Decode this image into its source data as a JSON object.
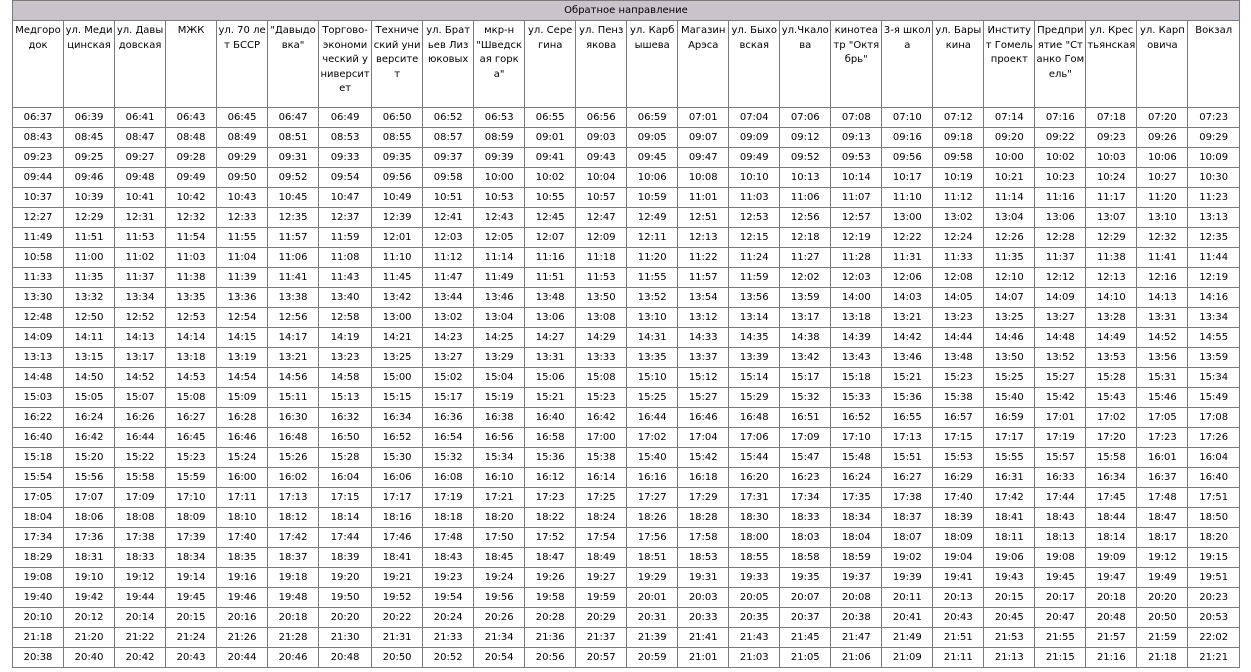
{
  "direction_title": "Обратное направление",
  "stops": [
    "Медгородок",
    "ул. Медицинская",
    "ул. Давыдовская",
    "МЖК",
    "ул. 70 лет БССР",
    "\"Давыдовка\"",
    "Торгово-экономический университет",
    "Технический университет",
    "ул. Братьев Лизюковых",
    "мкр-н \"Шведская горка\"",
    "ул. Серегина",
    "ул. Пензякова",
    "ул. Карбышева",
    "Магазин Арэса",
    "ул. Быховская",
    "ул.Чкалова",
    "кинотеатр \"Октябрь\"",
    "3-я школа",
    "ул. Барыкина",
    "Институт Гомельпроект",
    "Предприятие \"Станко Гомель\"",
    "ул. Крестьянская",
    "ул. Карповича",
    "Вокзал"
  ],
  "rows": [
    [
      "06:37",
      "06:39",
      "06:41",
      "06:43",
      "06:45",
      "06:47",
      "06:49",
      "06:50",
      "06:52",
      "06:53",
      "06:55",
      "06:56",
      "06:59",
      "07:01",
      "07:04",
      "07:06",
      "07:08",
      "07:10",
      "07:12",
      "07:14",
      "07:16",
      "07:18",
      "07:20",
      "07:23"
    ],
    [
      "08:43",
      "08:45",
      "08:47",
      "08:48",
      "08:49",
      "08:51",
      "08:53",
      "08:55",
      "08:57",
      "08:59",
      "09:01",
      "09:03",
      "09:05",
      "09:07",
      "09:09",
      "09:12",
      "09:13",
      "09:16",
      "09:18",
      "09:20",
      "09:22",
      "09:23",
      "09:26",
      "09:29"
    ],
    [
      "09:23",
      "09:25",
      "09:27",
      "09:28",
      "09:29",
      "09:31",
      "09:33",
      "09:35",
      "09:37",
      "09:39",
      "09:41",
      "09:43",
      "09:45",
      "09:47",
      "09:49",
      "09:52",
      "09:53",
      "09:56",
      "09:58",
      "10:00",
      "10:02",
      "10:03",
      "10:06",
      "10:09"
    ],
    [
      "09:44",
      "09:46",
      "09:48",
      "09:49",
      "09:50",
      "09:52",
      "09:54",
      "09:56",
      "09:58",
      "10:00",
      "10:02",
      "10:04",
      "10:06",
      "10:08",
      "10:10",
      "10:13",
      "10:14",
      "10:17",
      "10:19",
      "10:21",
      "10:23",
      "10:24",
      "10:27",
      "10:30"
    ],
    [
      "10:37",
      "10:39",
      "10:41",
      "10:42",
      "10:43",
      "10:45",
      "10:47",
      "10:49",
      "10:51",
      "10:53",
      "10:55",
      "10:57",
      "10:59",
      "11:01",
      "11:03",
      "11:06",
      "11:07",
      "11:10",
      "11:12",
      "11:14",
      "11:16",
      "11:17",
      "11:20",
      "11:23"
    ],
    [
      "12:27",
      "12:29",
      "12:31",
      "12:32",
      "12:33",
      "12:35",
      "12:37",
      "12:39",
      "12:41",
      "12:43",
      "12:45",
      "12:47",
      "12:49",
      "12:51",
      "12:53",
      "12:56",
      "12:57",
      "13:00",
      "13:02",
      "13:04",
      "13:06",
      "13:07",
      "13:10",
      "13:13"
    ],
    [
      "11:49",
      "11:51",
      "11:53",
      "11:54",
      "11:55",
      "11:57",
      "11:59",
      "12:01",
      "12:03",
      "12:05",
      "12:07",
      "12:09",
      "12:11",
      "12:13",
      "12:15",
      "12:18",
      "12:19",
      "12:22",
      "12:24",
      "12:26",
      "12:28",
      "12:29",
      "12:32",
      "12:35"
    ],
    [
      "10:58",
      "11:00",
      "11:02",
      "11:03",
      "11:04",
      "11:06",
      "11:08",
      "11:10",
      "11:12",
      "11:14",
      "11:16",
      "11:18",
      "11:20",
      "11:22",
      "11:24",
      "11:27",
      "11:28",
      "11:31",
      "11:33",
      "11:35",
      "11:37",
      "11:38",
      "11:41",
      "11:44"
    ],
    [
      "11:33",
      "11:35",
      "11:37",
      "11:38",
      "11:39",
      "11:41",
      "11:43",
      "11:45",
      "11:47",
      "11:49",
      "11:51",
      "11:53",
      "11:55",
      "11:57",
      "11:59",
      "12:02",
      "12:03",
      "12:06",
      "12:08",
      "12:10",
      "12:12",
      "12:13",
      "12:16",
      "12:19"
    ],
    [
      "13:30",
      "13:32",
      "13:34",
      "13:35",
      "13:36",
      "13:38",
      "13:40",
      "13:42",
      "13:44",
      "13:46",
      "13:48",
      "13:50",
      "13:52",
      "13:54",
      "13:56",
      "13:59",
      "14:00",
      "14:03",
      "14:05",
      "14:07",
      "14:09",
      "14:10",
      "14:13",
      "14:16"
    ],
    [
      "12:48",
      "12:50",
      "12:52",
      "12:53",
      "12:54",
      "12:56",
      "12:58",
      "13:00",
      "13:02",
      "13:04",
      "13:06",
      "13:08",
      "13:10",
      "13:12",
      "13:14",
      "13:17",
      "13:18",
      "13:21",
      "13:23",
      "13:25",
      "13:27",
      "13:28",
      "13:31",
      "13:34"
    ],
    [
      "14:09",
      "14:11",
      "14:13",
      "14:14",
      "14:15",
      "14:17",
      "14:19",
      "14:21",
      "14:23",
      "14:25",
      "14:27",
      "14:29",
      "14:31",
      "14:33",
      "14:35",
      "14:38",
      "14:39",
      "14:42",
      "14:44",
      "14:46",
      "14:48",
      "14:49",
      "14:52",
      "14:55"
    ],
    [
      "13:13",
      "13:15",
      "13:17",
      "13:18",
      "13:19",
      "13:21",
      "13:23",
      "13:25",
      "13:27",
      "13:29",
      "13:31",
      "13:33",
      "13:35",
      "13:37",
      "13:39",
      "13:42",
      "13:43",
      "13:46",
      "13:48",
      "13:50",
      "13:52",
      "13:53",
      "13:56",
      "13:59"
    ],
    [
      "14:48",
      "14:50",
      "14:52",
      "14:53",
      "14:54",
      "14:56",
      "14:58",
      "15:00",
      "15:02",
      "15:04",
      "15:06",
      "15:08",
      "15:10",
      "15:12",
      "15:14",
      "15:17",
      "15:18",
      "15:21",
      "15:23",
      "15:25",
      "15:27",
      "15:28",
      "15:31",
      "15:34"
    ],
    [
      "15:03",
      "15:05",
      "15:07",
      "15:08",
      "15:09",
      "15:11",
      "15:13",
      "15:15",
      "15:17",
      "15:19",
      "15:21",
      "15:23",
      "15:25",
      "15:27",
      "15:29",
      "15:32",
      "15:33",
      "15:36",
      "15:38",
      "15:40",
      "15:42",
      "15:43",
      "15:46",
      "15:49"
    ],
    [
      "16:22",
      "16:24",
      "16:26",
      "16:27",
      "16:28",
      "16:30",
      "16:32",
      "16:34",
      "16:36",
      "16:38",
      "16:40",
      "16:42",
      "16:44",
      "16:46",
      "16:48",
      "16:51",
      "16:52",
      "16:55",
      "16:57",
      "16:59",
      "17:01",
      "17:02",
      "17:05",
      "17:08"
    ],
    [
      "16:40",
      "16:42",
      "16:44",
      "16:45",
      "16:46",
      "16:48",
      "16:50",
      "16:52",
      "16:54",
      "16:56",
      "16:58",
      "17:00",
      "17:02",
      "17:04",
      "17:06",
      "17:09",
      "17:10",
      "17:13",
      "17:15",
      "17:17",
      "17:19",
      "17:20",
      "17:23",
      "17:26"
    ],
    [
      "15:18",
      "15:20",
      "15:22",
      "15:23",
      "15:24",
      "15:26",
      "15:28",
      "15:30",
      "15:32",
      "15:34",
      "15:36",
      "15:38",
      "15:40",
      "15:42",
      "15:44",
      "15:47",
      "15:48",
      "15:51",
      "15:53",
      "15:55",
      "15:57",
      "15:58",
      "16:01",
      "16:04"
    ],
    [
      "15:54",
      "15:56",
      "15:58",
      "15:59",
      "16:00",
      "16:02",
      "16:04",
      "16:06",
      "16:08",
      "16:10",
      "16:12",
      "16:14",
      "16:16",
      "16:18",
      "16:20",
      "16:23",
      "16:24",
      "16:27",
      "16:29",
      "16:31",
      "16:33",
      "16:34",
      "16:37",
      "16:40"
    ],
    [
      "17:05",
      "17:07",
      "17:09",
      "17:10",
      "17:11",
      "17:13",
      "17:15",
      "17:17",
      "17:19",
      "17:21",
      "17:23",
      "17:25",
      "17:27",
      "17:29",
      "17:31",
      "17:34",
      "17:35",
      "17:38",
      "17:40",
      "17:42",
      "17:44",
      "17:45",
      "17:48",
      "17:51"
    ],
    [
      "18:04",
      "18:06",
      "18:08",
      "18:09",
      "18:10",
      "18:12",
      "18:14",
      "18:16",
      "18:18",
      "18:20",
      "18:22",
      "18:24",
      "18:26",
      "18:28",
      "18:30",
      "18:33",
      "18:34",
      "18:37",
      "18:39",
      "18:41",
      "18:43",
      "18:44",
      "18:47",
      "18:50"
    ],
    [
      "17:34",
      "17:36",
      "17:38",
      "17:39",
      "17:40",
      "17:42",
      "17:44",
      "17:46",
      "17:48",
      "17:50",
      "17:52",
      "17:54",
      "17:56",
      "17:58",
      "18:00",
      "18:03",
      "18:04",
      "18:07",
      "18:09",
      "18:11",
      "18:13",
      "18:14",
      "18:17",
      "18:20"
    ],
    [
      "18:29",
      "18:31",
      "18:33",
      "18:34",
      "18:35",
      "18:37",
      "18:39",
      "18:41",
      "18:43",
      "18:45",
      "18:47",
      "18:49",
      "18:51",
      "18:53",
      "18:55",
      "18:58",
      "18:59",
      "19:02",
      "19:04",
      "19:06",
      "19:08",
      "19:09",
      "19:12",
      "19:15"
    ],
    [
      "19:08",
      "19:10",
      "19:12",
      "19:14",
      "19:16",
      "19:18",
      "19:20",
      "19:21",
      "19:23",
      "19:24",
      "19:26",
      "19:27",
      "19:29",
      "19:31",
      "19:33",
      "19:35",
      "19:37",
      "19:39",
      "19:41",
      "19:43",
      "19:45",
      "19:47",
      "19:49",
      "19:51"
    ],
    [
      "19:40",
      "19:42",
      "19:44",
      "19:45",
      "19:46",
      "19:48",
      "19:50",
      "19:52",
      "19:54",
      "19:56",
      "19:58",
      "19:59",
      "20:01",
      "20:03",
      "20:05",
      "20:07",
      "20:08",
      "20:11",
      "20:13",
      "20:15",
      "20:17",
      "20:18",
      "20:20",
      "20:23"
    ],
    [
      "20:10",
      "20:12",
      "20:14",
      "20:15",
      "20:16",
      "20:18",
      "20:20",
      "20:22",
      "20:24",
      "20:26",
      "20:28",
      "20:29",
      "20:31",
      "20:33",
      "20:35",
      "20:37",
      "20:38",
      "20:41",
      "20:43",
      "20:45",
      "20:47",
      "20:48",
      "20:50",
      "20:53"
    ],
    [
      "21:18",
      "21:20",
      "21:22",
      "21:24",
      "21:26",
      "21:28",
      "21:30",
      "21:31",
      "21:33",
      "21:34",
      "21:36",
      "21:37",
      "21:39",
      "21:41",
      "21:43",
      "21:45",
      "21:47",
      "21:49",
      "21:51",
      "21:53",
      "21:55",
      "21:57",
      "21:59",
      "22:02"
    ],
    [
      "20:38",
      "20:40",
      "20:42",
      "20:43",
      "20:44",
      "20:46",
      "20:48",
      "20:50",
      "20:52",
      "20:54",
      "20:56",
      "20:57",
      "20:59",
      "21:01",
      "21:03",
      "21:05",
      "21:06",
      "21:09",
      "21:11",
      "21:13",
      "21:15",
      "21:16",
      "21:18",
      "21:21"
    ]
  ]
}
